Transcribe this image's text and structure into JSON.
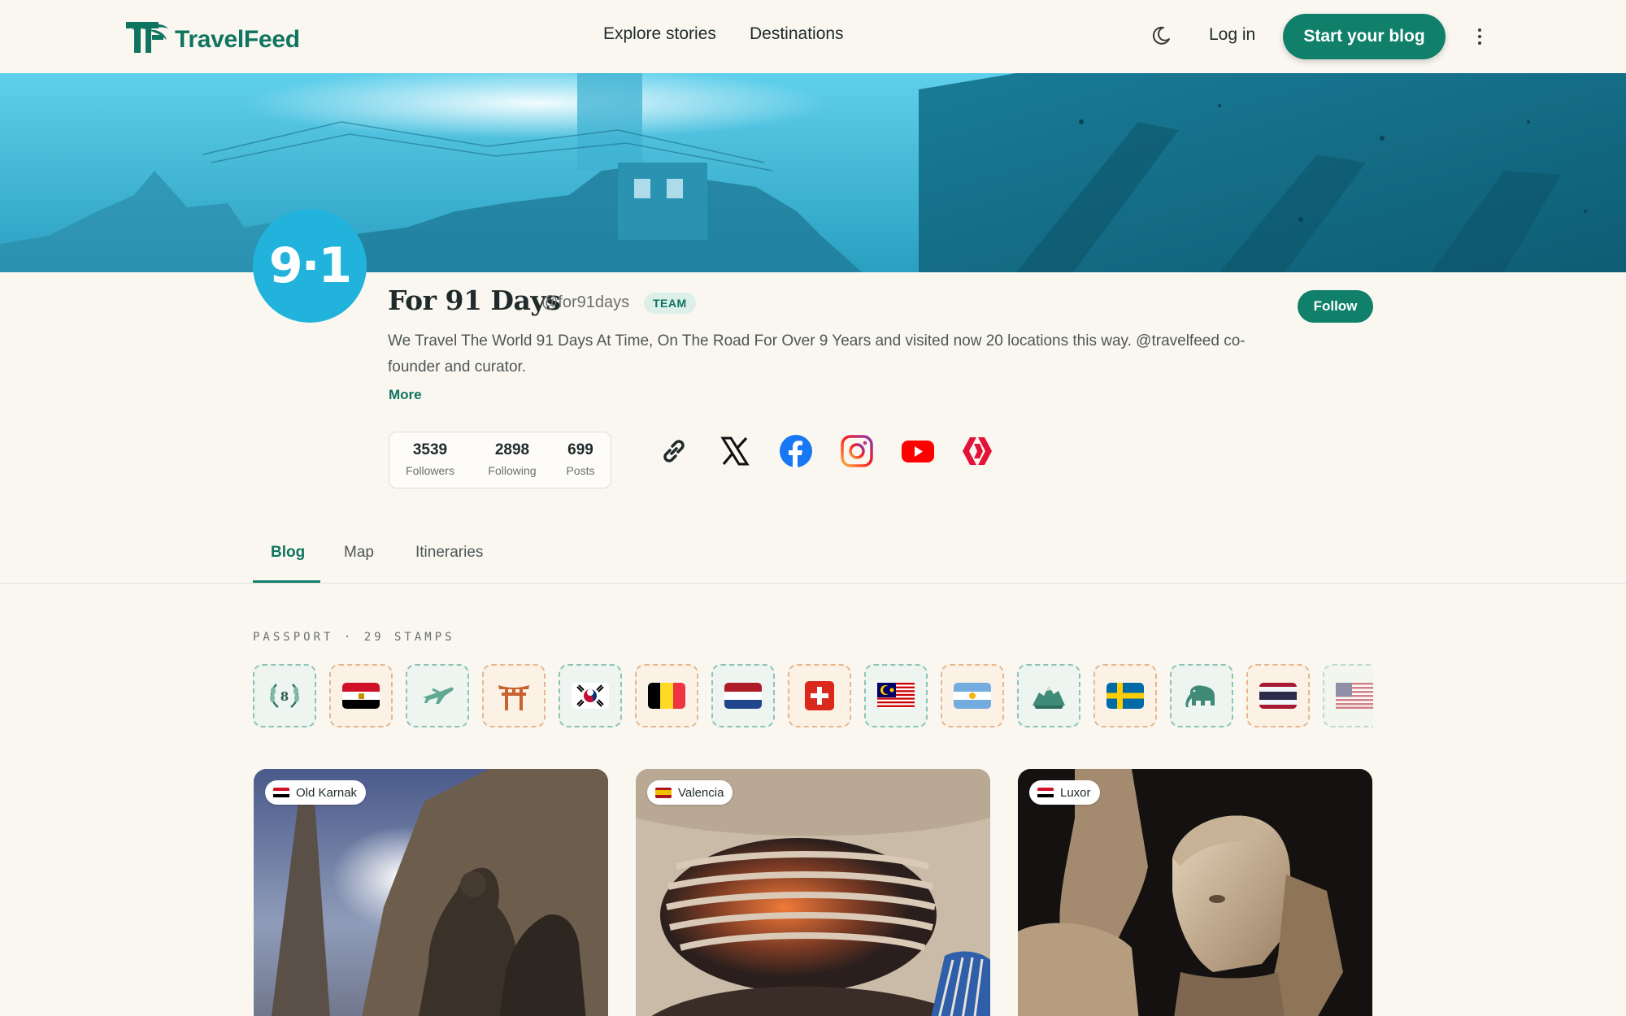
{
  "header": {
    "brand": "TravelFeed",
    "nav": [
      "Explore stories",
      "Destinations"
    ],
    "login": "Log in",
    "cta": "Start your blog"
  },
  "profile": {
    "avatar_text": "9·1",
    "name": "For 91 Days",
    "handle": "@for91days",
    "badge": "TEAM",
    "follow_label": "Follow",
    "bio": "We Travel The World 91 Days At Time, On The Road For Over 9 Years and visited now 20 locations this way. @travelfeed co-founder and curator.",
    "more_label": "More",
    "stats": [
      {
        "value": "3539",
        "label": "Followers"
      },
      {
        "value": "2898",
        "label": "Following"
      },
      {
        "value": "699",
        "label": "Posts"
      }
    ],
    "social": [
      "link-icon",
      "x-icon",
      "facebook-icon",
      "instagram-icon",
      "youtube-icon",
      "hive-icon"
    ]
  },
  "tabs": [
    {
      "label": "Blog",
      "active": true
    },
    {
      "label": "Map",
      "active": false
    },
    {
      "label": "Itineraries",
      "active": false
    }
  ],
  "passport": {
    "label": "PASSPORT · 29 STAMPS",
    "stamps": [
      "laurel-8-icon",
      "egypt-flag",
      "airplane-icon",
      "torii-gate-icon",
      "south-korea-flag",
      "belgium-flag",
      "netherlands-flag",
      "switzerland-flag",
      "malaysia-flag",
      "argentina-flag",
      "mountain-icon",
      "sweden-flag",
      "elephant-icon",
      "thailand-flag",
      "usa-flag"
    ]
  },
  "cards": [
    {
      "location": "Old Karnak",
      "flag": "egypt"
    },
    {
      "location": "Valencia",
      "flag": "spain"
    },
    {
      "location": "Luxor",
      "flag": "egypt"
    }
  ],
  "colors": {
    "brand": "#10806a",
    "background": "#faf7f1",
    "avatar": "#22b3dd"
  }
}
